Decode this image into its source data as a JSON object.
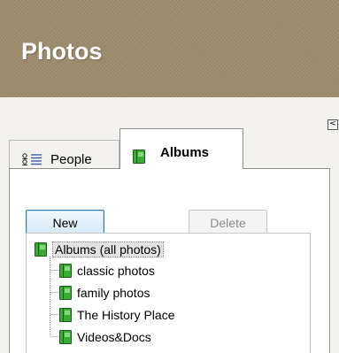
{
  "header": {
    "title": "Photos"
  },
  "panel": {
    "collapse_glyph": "<"
  },
  "tabs": {
    "people": {
      "label": "People",
      "icon": "people-list-icon"
    },
    "albums": {
      "label": "Albums",
      "icon": "album-book-icon"
    }
  },
  "buttons": {
    "new": "New",
    "delete": "Delete"
  },
  "tree": {
    "root": "Albums (all photos)",
    "items": [
      "classic photos",
      "family photos",
      "The History Place",
      "Videos&Docs"
    ]
  },
  "colors": {
    "header_bg": "#9c8c6c",
    "book_green": "#3cab35",
    "button_border": "#3d7bad"
  }
}
